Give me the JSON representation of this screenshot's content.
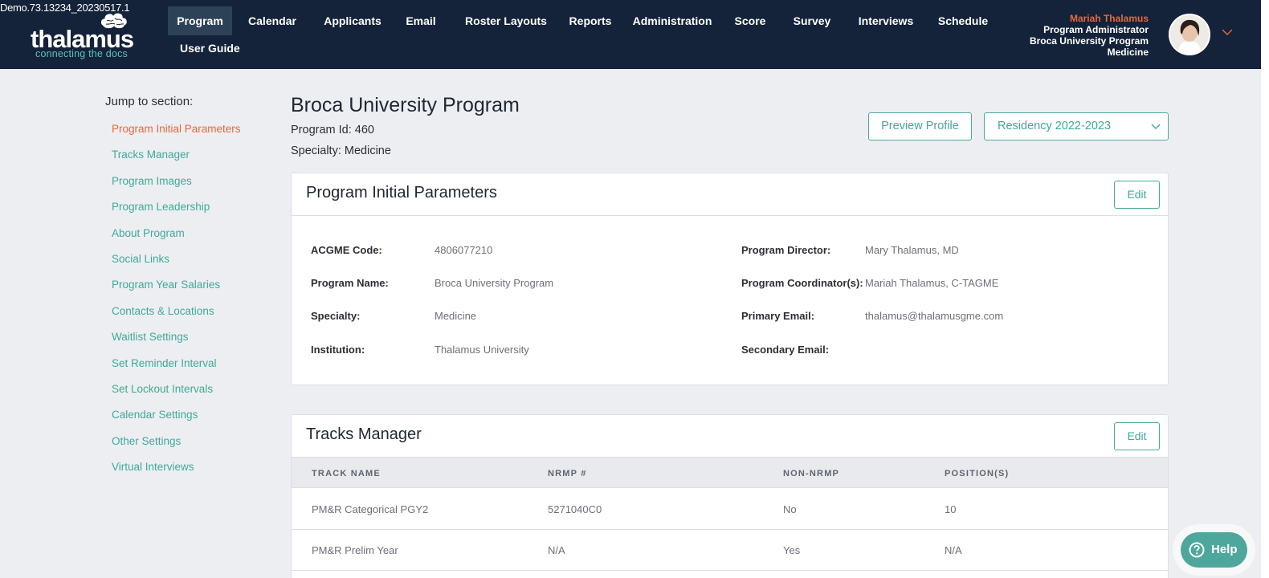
{
  "app": {
    "build_label": "Demo.73.13234_20230517.1",
    "logo_word": "thalamus",
    "logo_tagline": "connecting the docs"
  },
  "nav": {
    "items": [
      "Program",
      "Calendar",
      "Applicants",
      "Email",
      "Roster Layouts",
      "Reports",
      "Administration",
      "Score",
      "Survey",
      "Interviews",
      "Schedule"
    ],
    "active": "Program",
    "user_guide": "User Guide"
  },
  "user": {
    "name": "Mariah Thalamus",
    "role": "Program Administrator",
    "program": "Broca University Program",
    "specialty": "Medicine"
  },
  "sidebar": {
    "title": "Jump to section:",
    "links": [
      "Program Initial Parameters",
      "Tracks Manager",
      "Program Images",
      "Program Leadership",
      "About Program",
      "Social Links",
      "Program Year Salaries",
      "Contacts & Locations",
      "Waitlist Settings",
      "Set Reminder Interval",
      "Set Lockout Intervals",
      "Calendar Settings",
      "Other Settings",
      "Virtual Interviews"
    ],
    "active": "Program Initial Parameters"
  },
  "program": {
    "title": "Broca University Program",
    "id_line": "Program Id: 460",
    "specialty_line": "Specialty: Medicine",
    "preview_button": "Preview Profile",
    "season": "Residency 2022-2023"
  },
  "params_card": {
    "title": "Program Initial Parameters",
    "edit": "Edit",
    "left": [
      {
        "label": "ACGME Code:",
        "value": "4806077210"
      },
      {
        "label": "Program Name:",
        "value": "Broca University Program"
      },
      {
        "label": "Specialty:",
        "value": "Medicine"
      },
      {
        "label": "Institution:",
        "value": "Thalamus University"
      }
    ],
    "right": [
      {
        "label": "Program Director:",
        "value": "Mary Thalamus, MD"
      },
      {
        "label": "Program Coordinator(s):",
        "value": "Mariah Thalamus, C-TAGME"
      },
      {
        "label": "Primary Email:",
        "value": "thalamus@thalamusgme.com"
      },
      {
        "label": "Secondary Email:",
        "value": ""
      }
    ]
  },
  "tracks_card": {
    "title": "Tracks Manager",
    "edit": "Edit",
    "columns": [
      "TRACK NAME",
      "NRMP #",
      "NON-NRMP",
      "POSITION(S)"
    ],
    "rows": [
      [
        "PM&R Categorical PGY2",
        "5271040C0",
        "No",
        "10"
      ],
      [
        "PM&R Prelim Year",
        "N/A",
        "Yes",
        "N/A"
      ]
    ]
  },
  "help": {
    "label": "Help"
  },
  "colors": {
    "header_bg": "#14223a",
    "accent_teal": "#3ea99b",
    "accent_orange": "#e8683a",
    "page_bg": "#edeef1"
  }
}
